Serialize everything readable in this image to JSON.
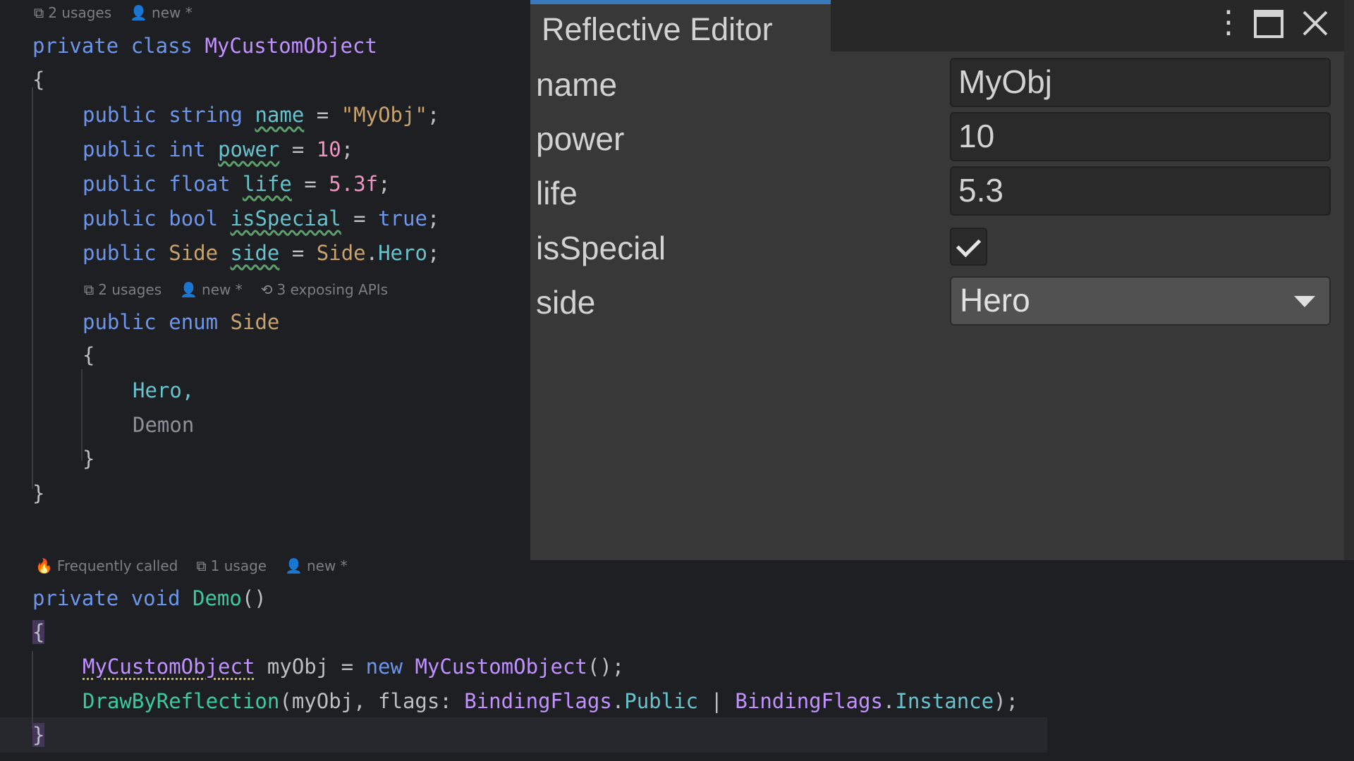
{
  "code": {
    "hint1": {
      "usages": "2 usages",
      "author": "new *"
    },
    "class_decl": {
      "mod": "private",
      "kw": "class",
      "name": "MyCustomObject"
    },
    "brace_open": "{",
    "fields": [
      {
        "mod": "public",
        "type": "string",
        "name": "name",
        "eq": " = ",
        "value": "\"MyObj\"",
        "end": ";"
      },
      {
        "mod": "public",
        "type": "int",
        "name": "power",
        "eq": " = ",
        "value": "10",
        "end": ";"
      },
      {
        "mod": "public",
        "type": "float",
        "name": "life",
        "eq": " = ",
        "value": "5.3f",
        "end": ";"
      },
      {
        "mod": "public",
        "type": "bool",
        "name": "isSpecial",
        "eq": " = ",
        "value": "true",
        "end": ";"
      },
      {
        "mod": "public",
        "type": "Side",
        "name": "side",
        "eq": " = ",
        "value_type": "Side",
        "dot": ".",
        "value": "Hero",
        "end": ";"
      }
    ],
    "hint2": {
      "usages": "2 usages",
      "author": "new *",
      "apis": "3 exposing APIs"
    },
    "enum_decl": {
      "mod": "public",
      "kw": "enum",
      "name": "Side"
    },
    "enum_brace_open": "{",
    "enum_values": [
      "Hero,",
      "Demon"
    ],
    "enum_brace_close": "}",
    "brace_close": "}",
    "hint3": {
      "freq": "Frequently called",
      "usages": "1 usage",
      "author": "new *"
    },
    "method_decl": {
      "mod": "private",
      "kw": "void",
      "name": "Demo",
      "parens": "()"
    },
    "method_brace_open": "{",
    "stmt1": {
      "type": "MyCustomObject",
      "var": " myObj = ",
      "kw": "new",
      "ctor": "MyCustomObject",
      "end": "();"
    },
    "stmt2": {
      "fn": "DrawByReflection",
      "args1": "(myObj, flags: ",
      "t1": "BindingFlags",
      "d1": ".",
      "m1": "Public",
      "pipe": " | ",
      "t2": "BindingFlags",
      "d2": ".",
      "m2": "Instance",
      "end": ");"
    },
    "method_brace_close": "}"
  },
  "panel": {
    "title": "Reflective Editor",
    "buttons": {
      "menu": "⋮",
      "maximize": "🗖",
      "close": "✕"
    },
    "props": [
      {
        "label": "name",
        "value": "MyObj"
      },
      {
        "label": "power",
        "value": "10"
      },
      {
        "label": "life",
        "value": "5.3"
      },
      {
        "label": "isSpecial",
        "checked": true
      },
      {
        "label": "side",
        "value": "Hero"
      }
    ]
  },
  "colors": {
    "accent": "#3a79bb",
    "panel_bg": "#383838",
    "editor_bg": "#1e1f22"
  }
}
